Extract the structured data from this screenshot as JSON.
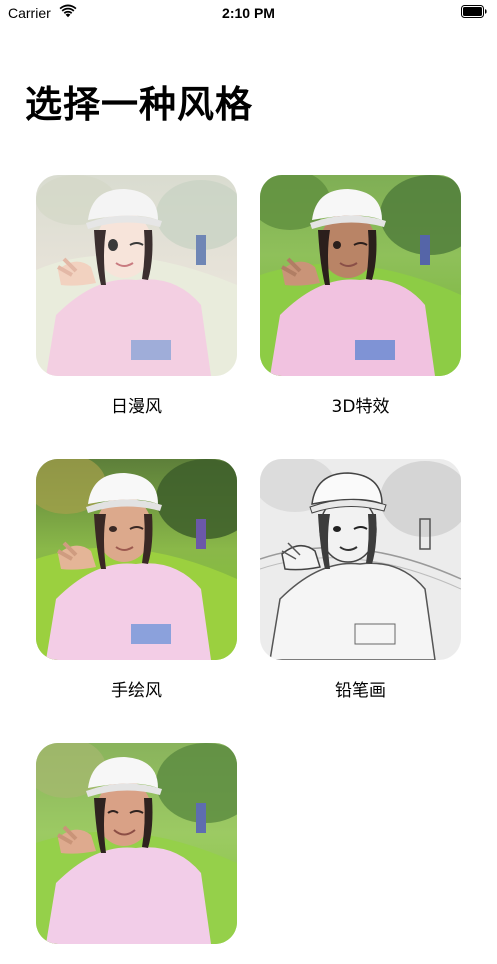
{
  "status_bar": {
    "carrier": "Carrier",
    "time": "2:10 PM",
    "icons": [
      "wifi-icon",
      "battery-icon"
    ]
  },
  "page": {
    "title": "选择一种风格"
  },
  "styles": [
    {
      "label": "日漫风",
      "thumbnail": "anime-style-photo"
    },
    {
      "label": "3D特效",
      "thumbnail": "3d-effect-photo"
    },
    {
      "label": "手绘风",
      "thumbnail": "hand-drawn-style-photo"
    },
    {
      "label": "铅笔画",
      "thumbnail": "pencil-sketch-photo"
    },
    {
      "label": "",
      "thumbnail": "partially-visible-style-photo"
    }
  ],
  "colors": {
    "background": "#ffffff",
    "text": "#000000"
  }
}
